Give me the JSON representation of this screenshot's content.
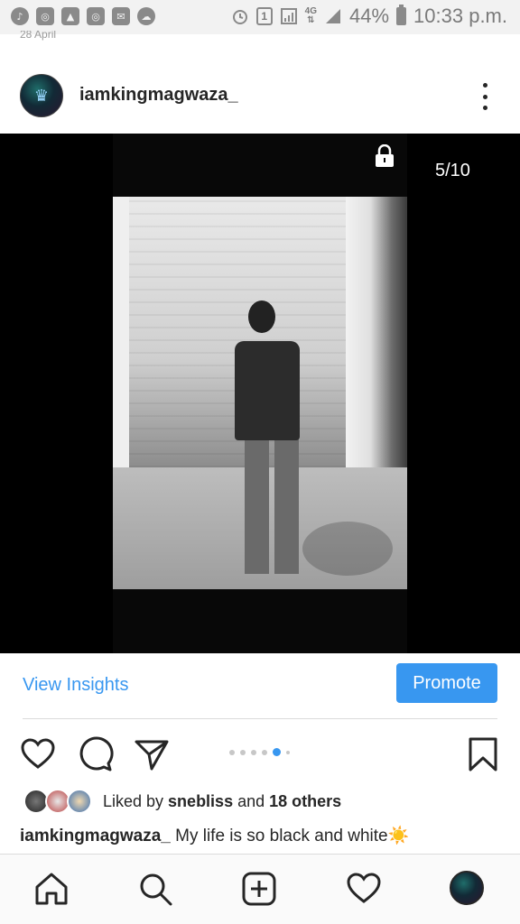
{
  "status_bar": {
    "battery": "44%",
    "time": "10:33 p.m.",
    "notification_icons": [
      "music-note-icon",
      "instagram-icon",
      "image-icon",
      "instagram-icon",
      "mail-icon",
      "cloud-icon"
    ],
    "sim_indicator": "1",
    "network": "4G"
  },
  "post": {
    "date_peek": "28 April",
    "username": "iamkingmagwaza_",
    "carousel_counter": "5/10",
    "carousel_dots": 6,
    "carousel_active_index": 4
  },
  "insights": {
    "view_label": "View Insights",
    "promote_label": "Promote"
  },
  "likes": {
    "prefix": "Liked by ",
    "user": "snebliss",
    "middle": " and ",
    "others": "18 others"
  },
  "caption": {
    "username": "iamkingmagwaza_",
    "text": " My life is so black and white",
    "emoji": "☀️"
  },
  "colors": {
    "accent": "#3897f0",
    "text": "#262626",
    "media_background": "#000000"
  }
}
